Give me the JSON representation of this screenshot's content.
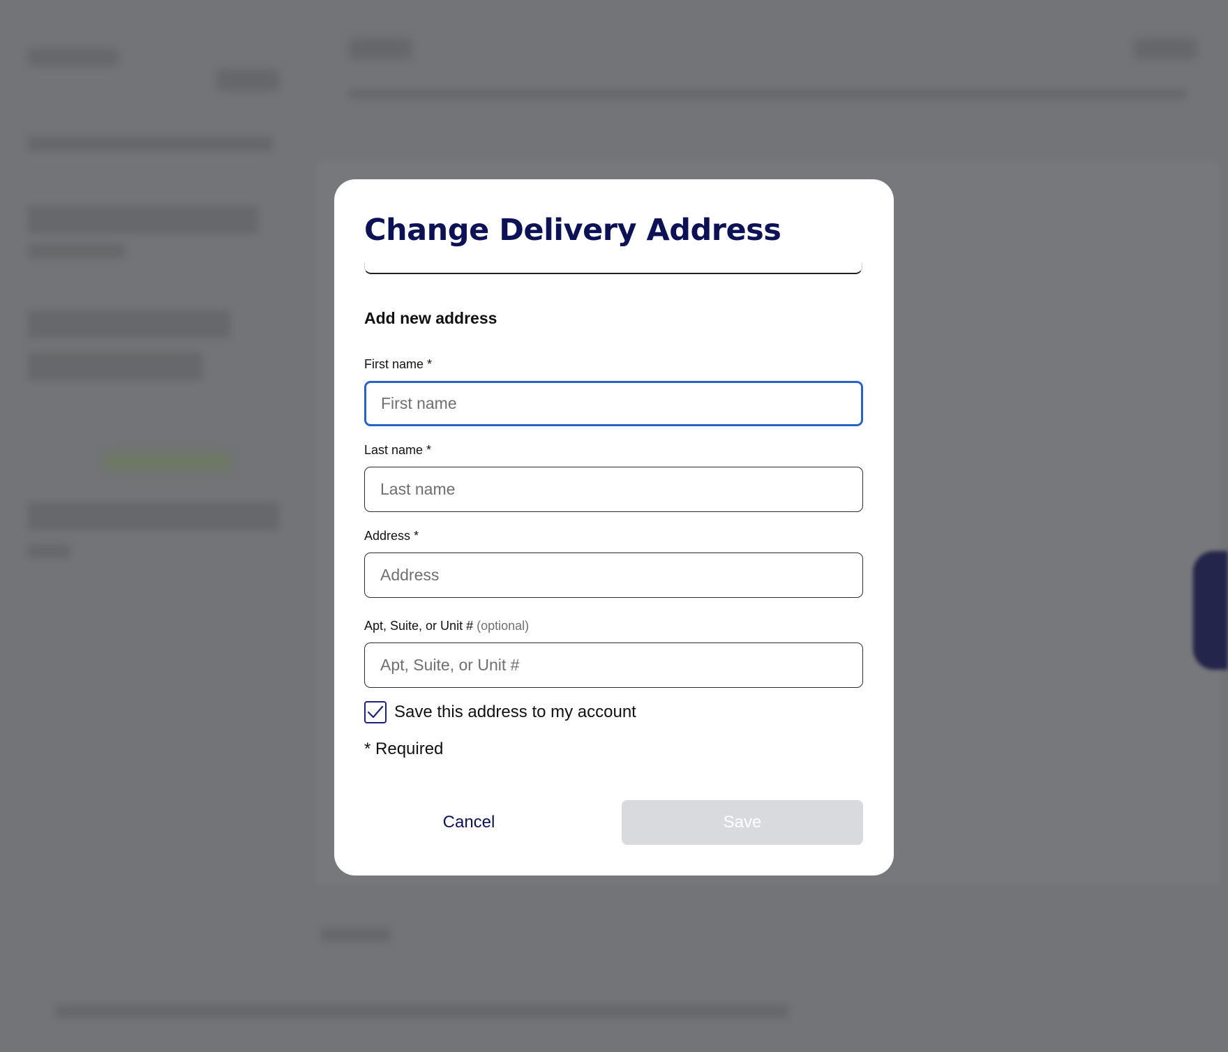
{
  "modal": {
    "title": "Change Delivery Address",
    "section_heading": "Add new address",
    "fields": {
      "first_name": {
        "label": "First name *",
        "placeholder": "First name",
        "value": ""
      },
      "last_name": {
        "label": "Last name *",
        "placeholder": "Last name",
        "value": ""
      },
      "address": {
        "label": "Address *",
        "placeholder": "Address",
        "value": ""
      },
      "apt": {
        "label": "Apt, Suite, or Unit #",
        "optional_note": "(optional)",
        "placeholder": "Apt, Suite, or Unit #",
        "value": ""
      }
    },
    "save_address_checkbox": {
      "label": "Save this address to my account",
      "checked": true
    },
    "required_note": "* Required",
    "actions": {
      "cancel_label": "Cancel",
      "save_label": "Save",
      "save_disabled": true
    }
  },
  "colors": {
    "title": "#0d1257",
    "focus_border": "#2563c9",
    "disabled_button": "#d9dadd",
    "overlay": "#727477"
  },
  "icons": {
    "checkbox_mark": "checkmark-icon"
  }
}
